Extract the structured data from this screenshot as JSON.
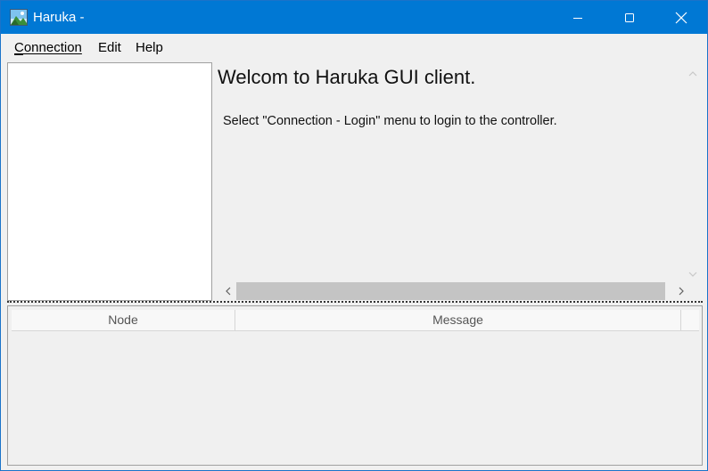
{
  "window": {
    "title": "Haruka -",
    "icon": "landscape-app-icon",
    "accent_color": "#0078d4"
  },
  "controls": {
    "minimize_icon": "minimize-icon",
    "maximize_icon": "maximize-icon",
    "close_icon": "close-icon"
  },
  "menu": {
    "items": [
      {
        "label": "Connection",
        "mnemonic": "C"
      },
      {
        "label": "Edit",
        "mnemonic": ""
      },
      {
        "label": "Help",
        "mnemonic": "H"
      }
    ]
  },
  "content": {
    "heading": "Welcom to Haruka GUI client.",
    "message": "Select \"Connection - Login\" menu to login to the controller."
  },
  "log_table": {
    "columns": [
      "Node",
      "Message"
    ],
    "rows": []
  }
}
